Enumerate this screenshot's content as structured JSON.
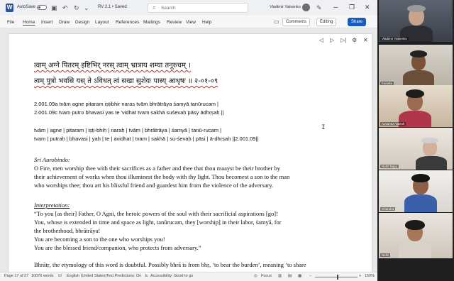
{
  "titlebar": {
    "autosave_label": "AutoSave",
    "autosave_state": "Off",
    "doc_title": "RV 2.1 • Saved",
    "search_placeholder": "Search",
    "user_name": "Vladimir Yatsenko"
  },
  "menu": {
    "items": [
      "File",
      "Home",
      "Insert",
      "Draw",
      "Design",
      "Layout",
      "References",
      "Mailings",
      "Review",
      "View",
      "Help"
    ],
    "comments_label": "Comments",
    "editing_label": "Editing",
    "share_label": "Share"
  },
  "document": {
    "devanagari_line1": "त्वाम् अग्ने पितरम् इष्टिभिर् नरस् त्वाम् भ्रात्राय शम्या तनूरुचम् ।",
    "devanagari_line2": "त्वम् पुत्रो भवसि यस् ते ऽविधत् त्वं सखा सुशेवः पास्य् आधृषः ॥ २-०१-०९",
    "translit_a": "2.001.09a tvām agne pitaram iṣṭibhir naras tvām bhrātrāya śamyā tanūrucam |",
    "translit_c": "2.001.09c tvam putro bhavasi yas te 'vidhat tvam sakhā suśevaḥ pāsy ādhṛṣaḥ ||",
    "segments_1": [
      "tvām",
      "agne",
      "pitaram",
      "iṣṭi-bhiḥ",
      "naraḥ",
      "tvām",
      "bhrātrāya",
      "śamyā",
      "tanū-rucam"
    ],
    "segments_2": [
      "tvam",
      "putraḥ",
      "bhavasi",
      "yaḥ",
      "te",
      "avidhat",
      "tvam",
      "sakhā",
      "su-śevaḥ",
      "pāsi",
      "ā-dhṛṣaḥ"
    ],
    "segments_2_ref": "2.001.09",
    "sri_aurobindo_heading": "Sri Aurobindo:",
    "aurobindo_text": [
      "O Fire, men worship thee with their sacrifices as a father and thee that  thou maayst be their brother by",
      "their achievement of works when thou illuminest the body with thy light. Thou becomest a son to the man",
      "who worships thee; thou art his blissful friend and guardest him from the violence of the adversary."
    ],
    "interpretation_heading": "Interpretation:",
    "interpretation_text": [
      "“To you [as their] Father, O Agni, the heroic powers of the soul with their sacrificial aspirations [go]!",
      "You, whose is extended in time and space as light, tanūrucam, they [worship] in their labor, śamyā, for",
      "the brotherhood, bhrātrāya!",
      "You are becoming a son to the one who worships you!",
      "You are the blessed friend/companion, who protects from adversary.”"
    ],
    "footnote_text": "Bhrātṛ, the etymology of this word is doubtful. Possibly bhrā is from bhṛ, ‘to bear the burden’, meaning ‘to share"
  },
  "statusbar": {
    "page": "Page 17 of 27",
    "words": "10076 words",
    "language": "English (United States)",
    "text_predictions": "Text Predictions: On",
    "accessibility": "Accessibility: Good to go",
    "focus": "Focus",
    "zoom": "150%"
  },
  "participants": [
    {
      "name": "Vladimir Yatsenko"
    },
    {
      "name": "Kanaka"
    },
    {
      "name": "Auvanna Valesh"
    },
    {
      "name": "Rohit Bajaj"
    },
    {
      "name": "Chandra"
    },
    {
      "name": "Nidhi"
    }
  ]
}
